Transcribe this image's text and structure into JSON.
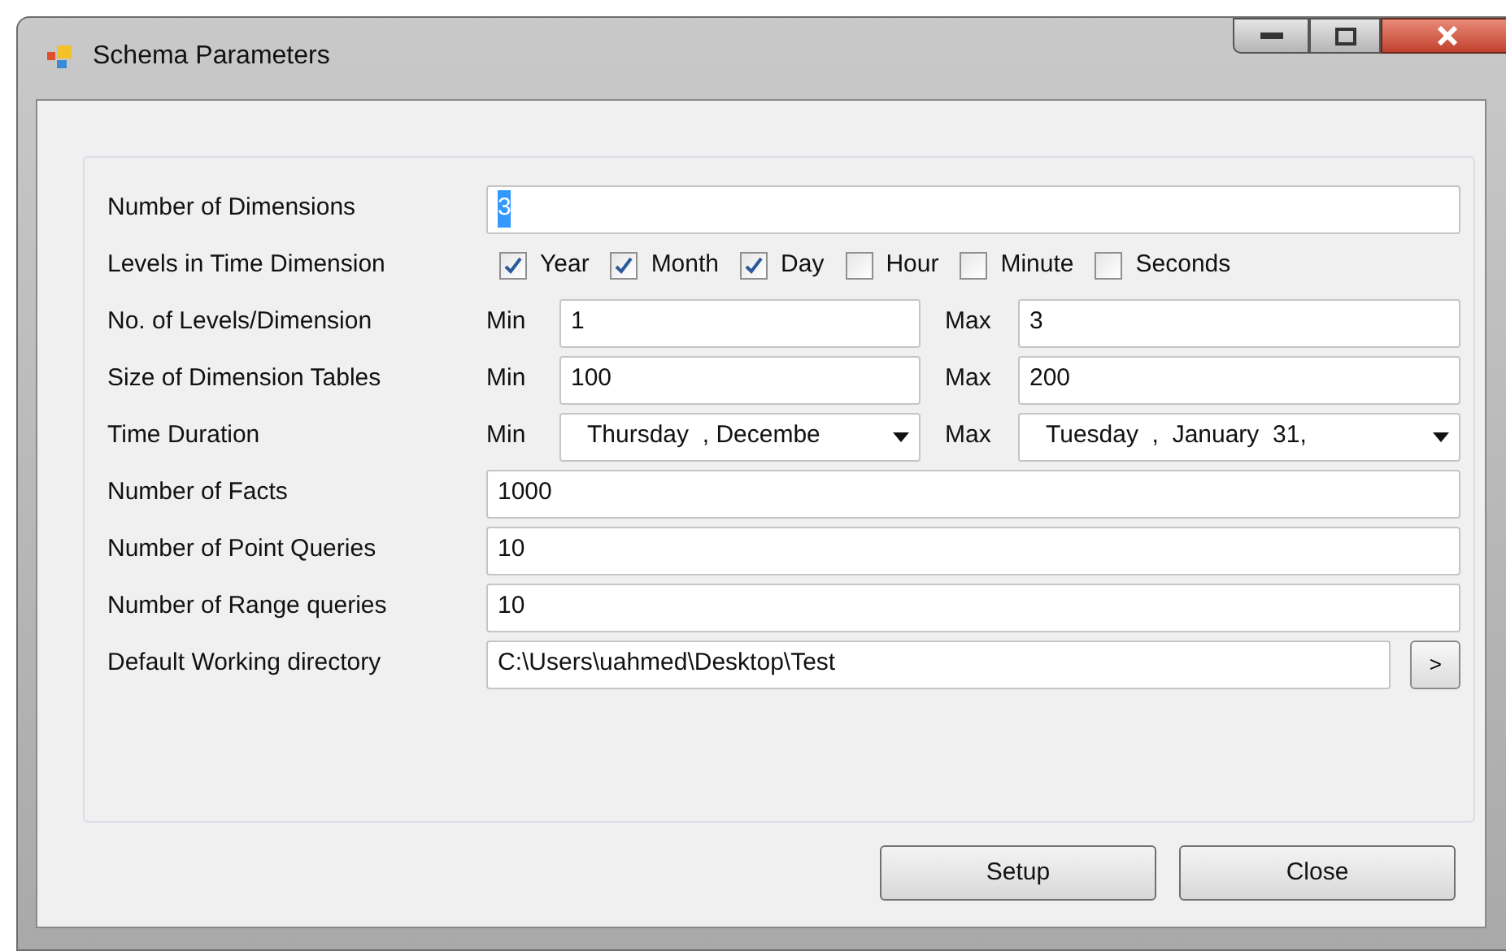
{
  "window": {
    "title": "Schema Parameters"
  },
  "fields": [
    {
      "kind": "text",
      "label": "Number of Dimensions",
      "value": "3",
      "highlighted": true
    },
    {
      "kind": "checks",
      "label": "Levels in Time Dimension",
      "options": [
        {
          "label": "Year",
          "checked": true
        },
        {
          "label": "Month",
          "checked": true
        },
        {
          "label": "Day",
          "checked": true
        },
        {
          "label": "Hour",
          "checked": false
        },
        {
          "label": "Minute",
          "checked": false
        },
        {
          "label": "Seconds",
          "checked": false
        }
      ]
    },
    {
      "kind": "range",
      "label": "No. of Levels/Dimension",
      "min_label": "Min",
      "min": "1",
      "max_label": "Max",
      "max": "3"
    },
    {
      "kind": "range",
      "label": "Size of Dimension Tables",
      "min_label": "Min",
      "min": "100",
      "max_label": "Max",
      "max": "200"
    },
    {
      "kind": "dates",
      "label": "Time Duration",
      "min_label": "Min",
      "min": "Thursday  , Decembe",
      "max_label": "Max",
      "max": "Tuesday  ,  January  31,"
    },
    {
      "kind": "text",
      "label": "Number of Facts",
      "value": "1000",
      "highlighted": false
    },
    {
      "kind": "text",
      "label": "Number of Point Queries",
      "value": "10",
      "highlighted": false
    },
    {
      "kind": "text",
      "label": "Number of Range queries",
      "value": "10",
      "highlighted": false
    },
    {
      "kind": "path",
      "label": "Default Working directory",
      "value": "C:\\Users\\uahmed\\Desktop\\Test",
      "button": ">"
    }
  ],
  "buttons": [
    "Setup",
    "Close"
  ]
}
